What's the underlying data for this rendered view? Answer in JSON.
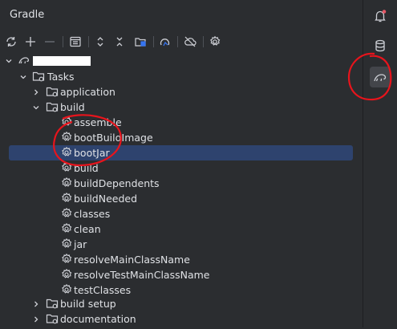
{
  "panel": {
    "title": "Gradle"
  },
  "toolbar": {
    "buttons": [
      "reload-icon",
      "add-icon",
      "remove-icon",
      "tasks-view-icon",
      "expand-all-icon",
      "collapse-all-icon",
      "link-project-icon",
      "execute-task-icon",
      "offline-mode-icon",
      "settings-icon"
    ]
  },
  "tree": {
    "project_name": "",
    "tasks_label": "Tasks",
    "groups": {
      "application": "application",
      "build": "build",
      "build_setup": "build setup",
      "documentation": "documentation"
    },
    "build_tasks": [
      "assemble",
      "bootBuildImage",
      "bootJar",
      "build",
      "buildDependents",
      "buildNeeded",
      "classes",
      "clean",
      "jar",
      "resolveMainClassName",
      "resolveTestMainClassName",
      "testClasses"
    ],
    "selected": "bootJar"
  },
  "side_stripe": {
    "items": [
      "notifications-icon",
      "database-icon",
      "gradle-icon"
    ],
    "active": "gradle-icon"
  },
  "colors": {
    "background": "#2b2d30",
    "selection": "#2e436e",
    "annotation": "#e8141c",
    "notification_dot": "#e55765"
  }
}
